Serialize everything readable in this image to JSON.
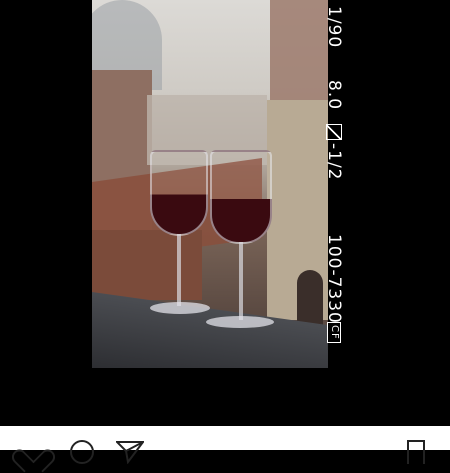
{
  "camera_info": {
    "shutter": "1/90",
    "aperture": "8.0",
    "exposure_comp": "-1/2",
    "frame_counter": "100-7330",
    "card_label": "CF"
  },
  "post_actions": {
    "like_icon": "heart-icon",
    "comment_icon": "comment-icon",
    "share_icon": "share-icon",
    "save_icon": "bookmark-icon"
  },
  "colors": {
    "background": "#000000",
    "action_bar": "#ffffff",
    "overlay_text": "#ffffff"
  }
}
